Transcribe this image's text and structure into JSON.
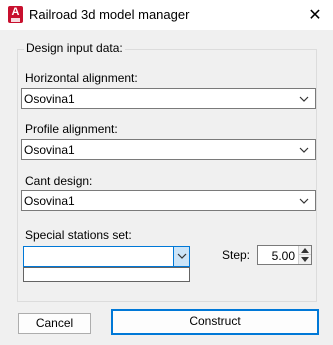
{
  "window": {
    "title": "Railroad 3d model manager",
    "close_glyph": "✕",
    "app_icon": "autocad-icon"
  },
  "group": {
    "legend": "Design input data:"
  },
  "horizontal": {
    "label": "Horizontal alignment:",
    "value": "Osovina1"
  },
  "profile": {
    "label": "Profile alignment:",
    "value": "Osovina1"
  },
  "cant": {
    "label": "Cant design:",
    "value": "Osovina1"
  },
  "special": {
    "label": "Special stations set:",
    "value": ""
  },
  "step": {
    "label": "Step:",
    "value": "5.00"
  },
  "buttons": {
    "cancel": "Cancel",
    "construct": "Construct"
  },
  "colors": {
    "accent": "#0078d7",
    "app_icon_bg": "#c8102e"
  }
}
